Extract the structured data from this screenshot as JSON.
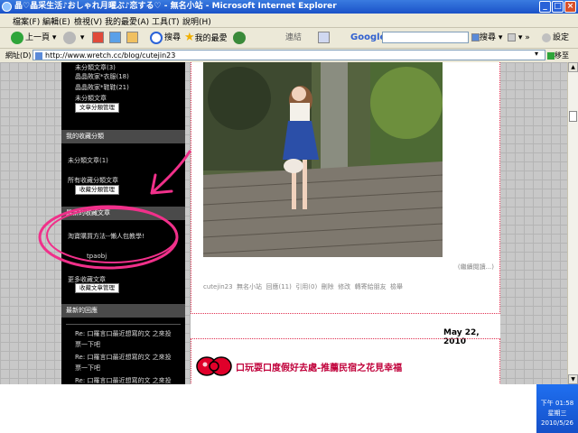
{
  "window": {
    "title": "晶♡晶采生活♪おしゃれ月曜ぶ♪恋する♡ - 無名小站 - Microsoft Internet Explorer"
  },
  "menu": [
    "檔案(F)",
    "編輯(E)",
    "檢視(V)",
    "我的最愛(A)",
    "工具(T)",
    "說明(H)"
  ],
  "toolbar": {
    "back": "上一頁",
    "search": "搜尋",
    "favorites": "我的最愛",
    "links": "連結",
    "google_label": "Google",
    "google_search": "搜尋",
    "settings": "設定"
  },
  "address": {
    "label": "網址(D)",
    "url": "http://www.wretch.cc/blog/cutejin23",
    "go": "移至"
  },
  "sidebar": {
    "cat_items": [
      "未分類文章(3)",
      "晶晶敗家*衣服(18)",
      "晶晶敗家*鞋鞋(21)",
      "未分類文章"
    ],
    "cat_button": "文章分類管理",
    "fav_header": "我的收藏分類",
    "fav_item": "未分類文章(1)",
    "fav_all": "所有收藏分類文章",
    "fav_button": "收藏分類管理",
    "recent_header": "最新的收藏文章",
    "recent_item": "淘寶購買方法--懶人包教學!",
    "recent_author": "tpaobj",
    "recent_more": "更多收藏文章",
    "recent_button": "收藏文章管理",
    "reply_header": "最新的回應",
    "replies": [
      "Re: 口羅言口最近想寫的文 之來投",
      "票一下吧",
      "Re: 口羅言口最近想寫的文 之來投",
      "票一下吧",
      "Re: 口羅言口最近想寫的文 之來投"
    ]
  },
  "post1": {
    "readmore": "(繼續閱讀...)",
    "meta": [
      "cutejin23",
      "無名小站",
      "回應(11)",
      "引用(0)",
      "刪除",
      "修改",
      "轉寄給朋友",
      "檢舉"
    ]
  },
  "post2": {
    "date": "May 22, 2010",
    "title": "口玩耍口度假好去處-推薦民宿之花見幸福"
  },
  "tray": {
    "time": "下午 01:58",
    "weekday": "星期三",
    "date": "2010/5/26"
  },
  "colors": {
    "accent_pink": "#e03050",
    "title_red": "#c0003a",
    "titlebar_blue": "#1a52c8"
  }
}
